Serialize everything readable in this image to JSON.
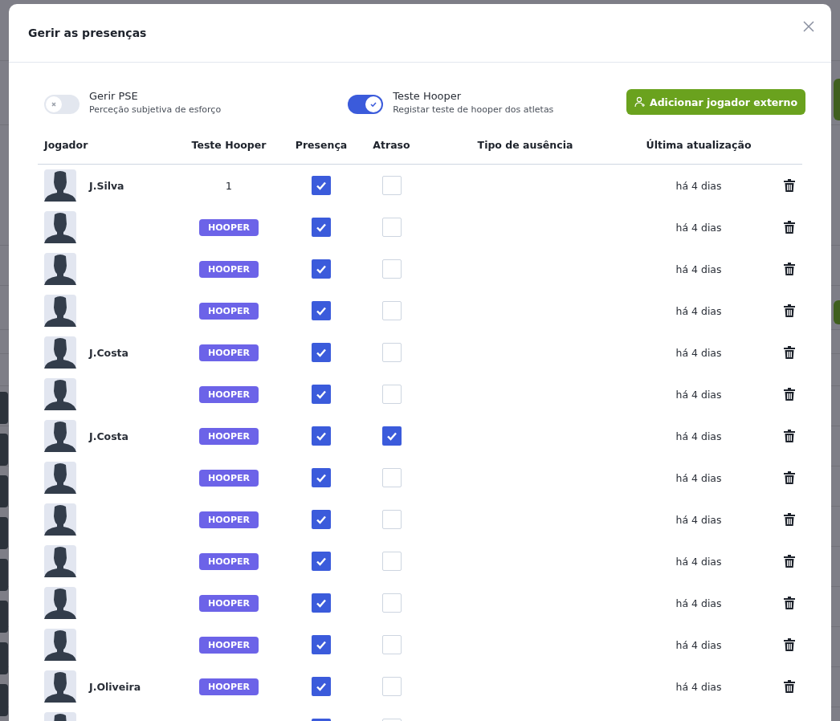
{
  "dialog": {
    "title": "Gerir as presenças"
  },
  "toggles": [
    {
      "label": "Gerir PSE",
      "description": "Perceção subjetiva de esforço",
      "on": false
    },
    {
      "label": "Teste Hooper",
      "description": "Registar teste de hooper dos atletas",
      "on": true
    }
  ],
  "add_button": {
    "label": "Adicionar jogador externo"
  },
  "table": {
    "columns": [
      "Jogador",
      "Teste Hooper",
      "Presença",
      "Atraso",
      "Tipo de ausência",
      "Última atualização"
    ],
    "rows": [
      {
        "name": "J.Silva",
        "hooper": {
          "kind": "value",
          "text": "1"
        },
        "present": true,
        "late": false,
        "updated": "há 4 dias"
      },
      {
        "hooper": {
          "kind": "badge",
          "text": "HOOPER"
        },
        "present": true,
        "late": false,
        "updated": "há 4 dias"
      },
      {
        "hooper": {
          "kind": "badge",
          "text": "HOOPER"
        },
        "present": true,
        "late": false,
        "updated": "há 4 dias"
      },
      {
        "hooper": {
          "kind": "badge",
          "text": "HOOPER"
        },
        "present": true,
        "late": false,
        "updated": "há 4 dias"
      },
      {
        "name": "J.Costa",
        "hooper": {
          "kind": "badge",
          "text": "HOOPER"
        },
        "present": true,
        "late": false,
        "updated": "há 4 dias"
      },
      {
        "hooper": {
          "kind": "badge",
          "text": "HOOPER"
        },
        "present": true,
        "late": false,
        "updated": "há 4 dias"
      },
      {
        "name": "J.Costa",
        "hooper": {
          "kind": "badge",
          "text": "HOOPER"
        },
        "present": true,
        "late": true,
        "updated": "há 4 dias"
      },
      {
        "hooper": {
          "kind": "badge",
          "text": "HOOPER"
        },
        "present": true,
        "late": false,
        "updated": "há 4 dias"
      },
      {
        "hooper": {
          "kind": "badge",
          "text": "HOOPER"
        },
        "present": true,
        "late": false,
        "updated": "há 4 dias"
      },
      {
        "hooper": {
          "kind": "badge",
          "text": "HOOPER"
        },
        "present": true,
        "late": false,
        "updated": "há 4 dias"
      },
      {
        "hooper": {
          "kind": "badge",
          "text": "HOOPER"
        },
        "present": true,
        "late": false,
        "updated": "há 4 dias"
      },
      {
        "hooper": {
          "kind": "badge",
          "text": "HOOPER"
        },
        "present": true,
        "late": false,
        "updated": "há 4 dias"
      },
      {
        "name": "J.Oliveira",
        "hooper": {
          "kind": "badge",
          "text": "HOOPER"
        },
        "present": true,
        "late": false,
        "updated": "há 4 dias"
      },
      {
        "present": true,
        "late": false
      }
    ]
  }
}
